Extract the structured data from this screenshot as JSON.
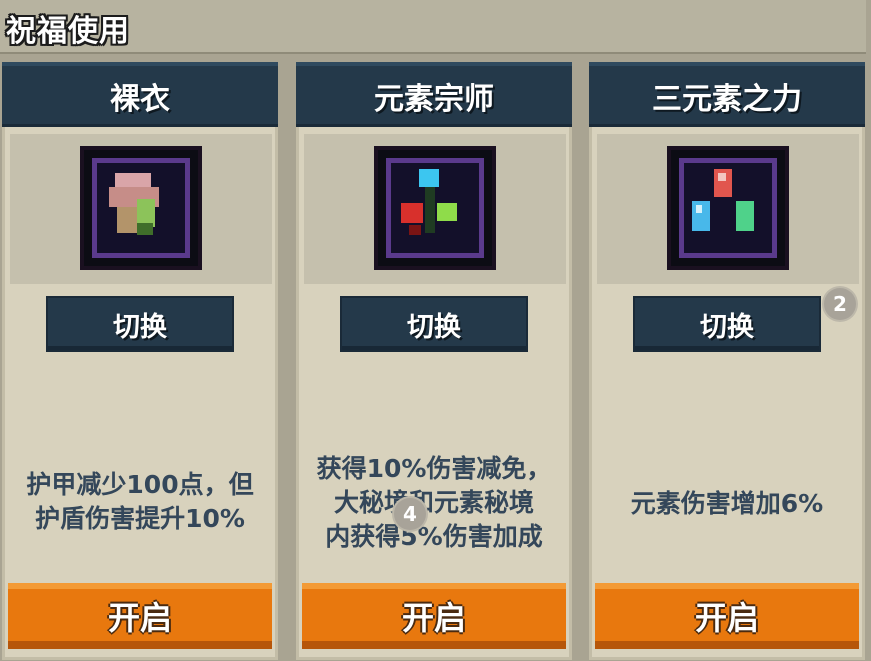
{
  "page": {
    "title": "祝福使用"
  },
  "cards": [
    {
      "title": "裸衣",
      "icon": "pink-armor-icon",
      "switch_label": "切换",
      "description": [
        "护甲减少100点，但",
        "护盾伤害提升10%"
      ],
      "open_label": "开启"
    },
    {
      "title": "元素宗师",
      "icon": "element-master-gems-icon",
      "switch_label": "切换",
      "description": [
        "获得10%伤害减免，",
        "大秘境和元素秘境",
        "内获得5%伤害加成"
      ],
      "open_label": "开启",
      "badge": "4"
    },
    {
      "title": "三元素之力",
      "icon": "three-element-crystals-icon",
      "switch_label": "切换",
      "description": [
        "元素伤害增加6%"
      ],
      "open_label": "开启",
      "badge": "2"
    }
  ],
  "colors": {
    "header": "#24394a",
    "card": "#d8d2bd",
    "open_button": "#e8780e",
    "description_text": "#34475a"
  }
}
